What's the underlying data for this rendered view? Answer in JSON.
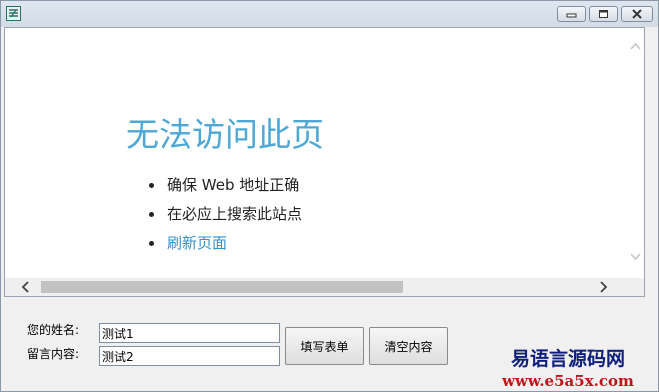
{
  "window": {
    "controls": {
      "minimize": "minimize",
      "maximize": "maximize",
      "close": "close"
    }
  },
  "browser": {
    "error_title": "无法访问此页",
    "suggestions": [
      "确保 Web 地址正确",
      "在必应上搜索此站点",
      "刷新页面"
    ],
    "link_color": "#3592c9",
    "title_color": "#4fa7d6"
  },
  "form": {
    "name_label": "您的姓名:",
    "message_label": "留言内容:",
    "name_value": "测试1",
    "message_value": "测试2",
    "fill_button": "填写表单",
    "clear_button": "清空内容"
  },
  "watermark": {
    "title": "易语言源码网",
    "url": "www.e5a5x.com"
  }
}
